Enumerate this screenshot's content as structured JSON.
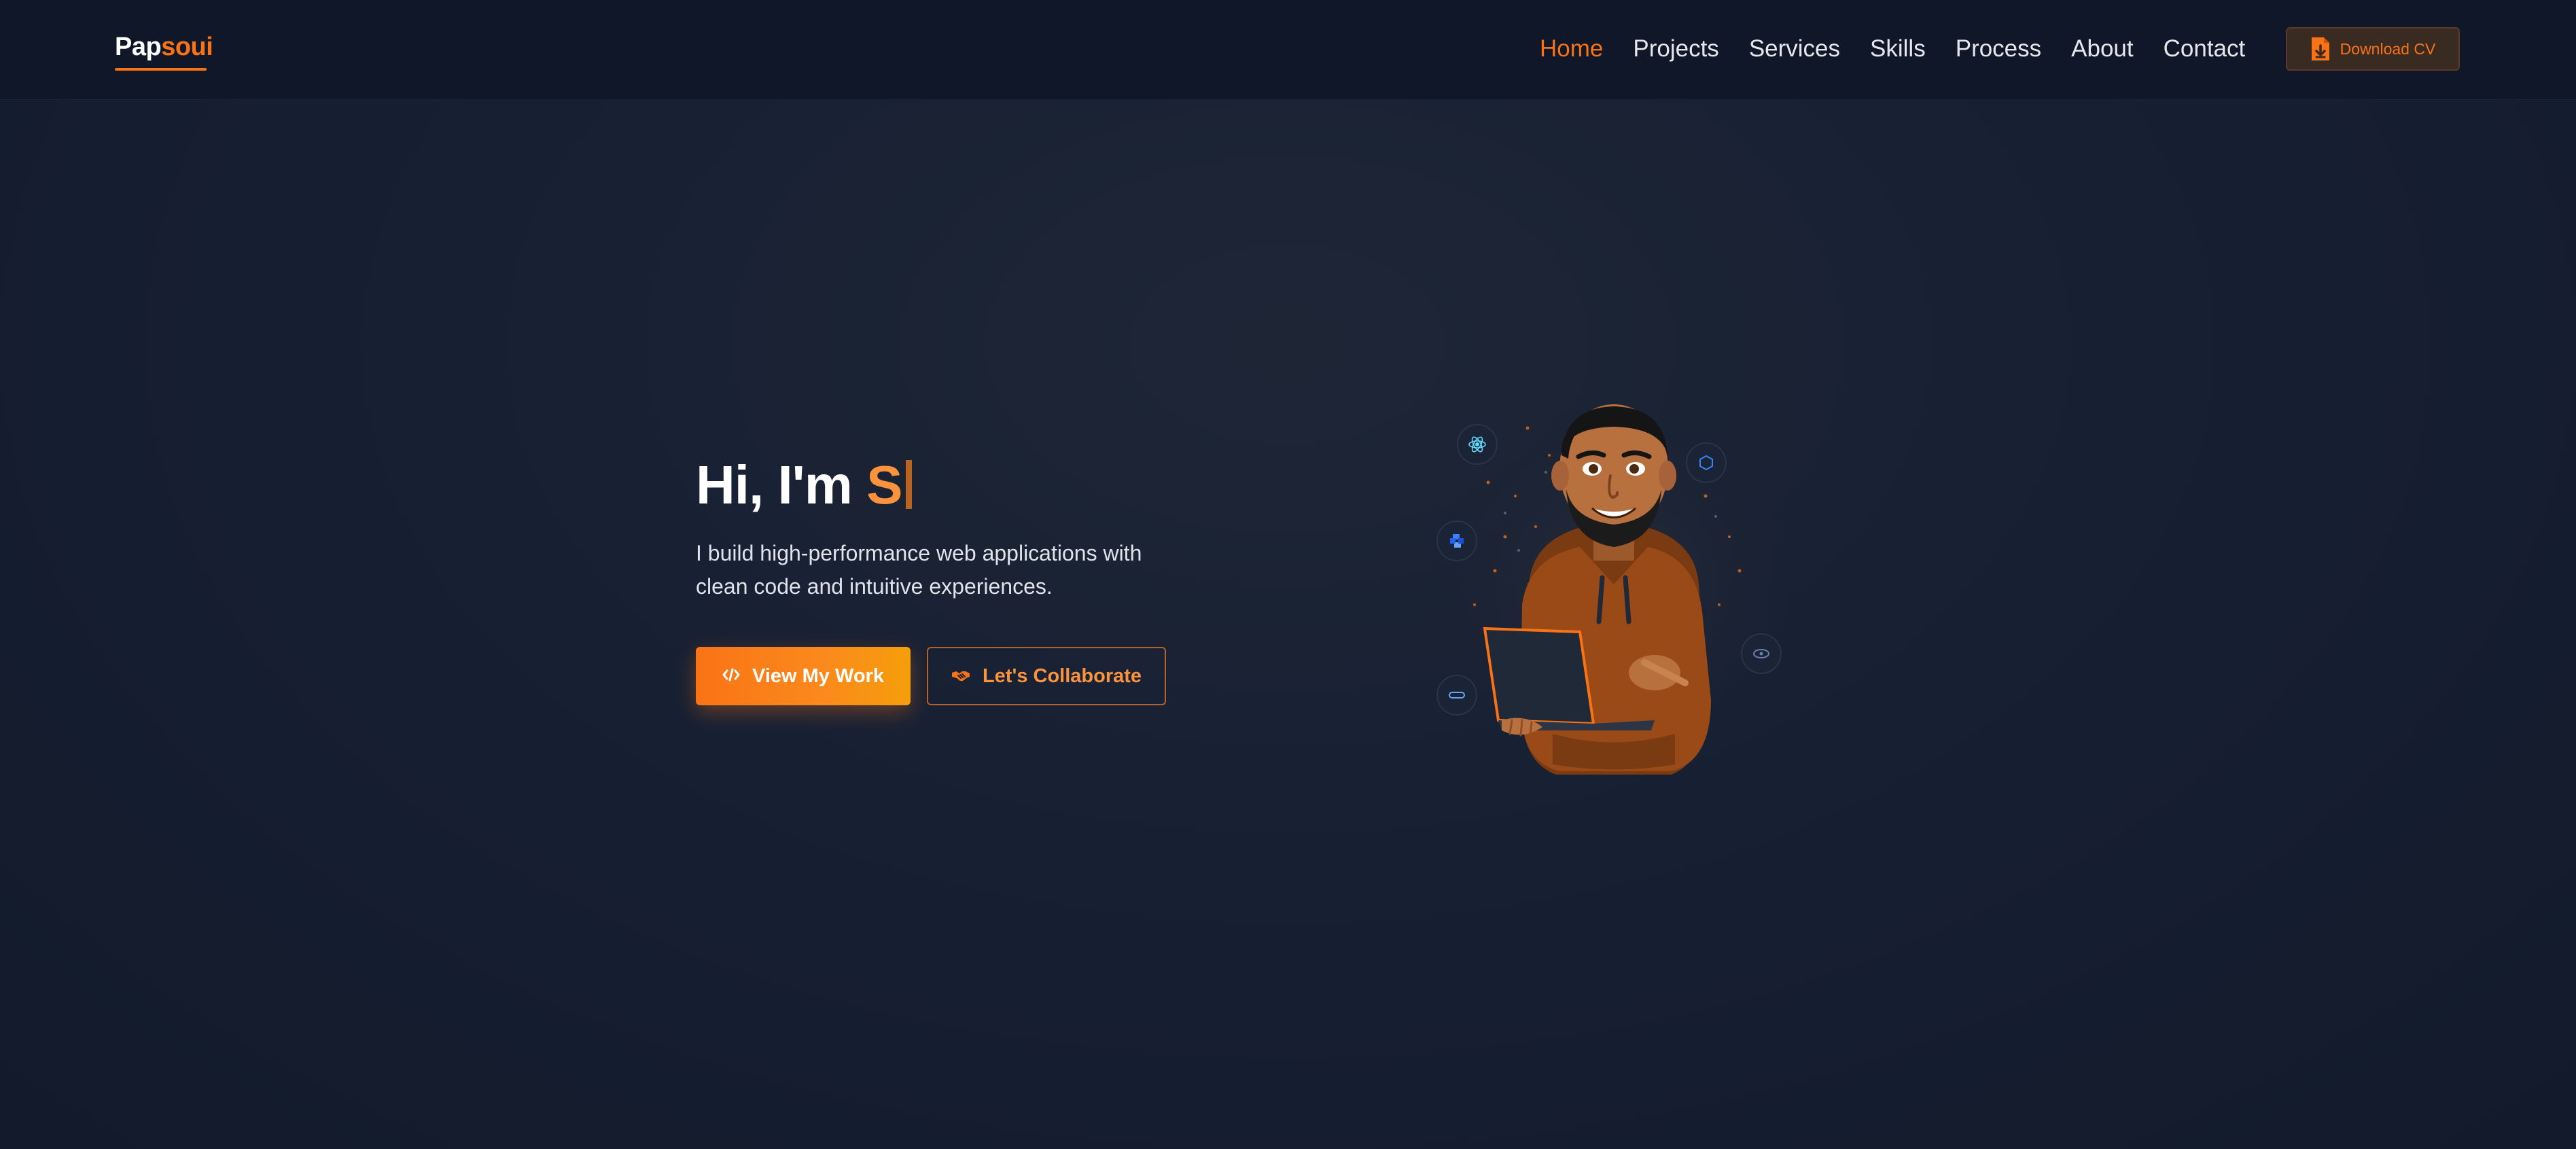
{
  "brand": {
    "prefix": "Pap",
    "suffix": "soui",
    "accent": "#f97316"
  },
  "nav": {
    "items": [
      {
        "label": "Home",
        "active": true
      },
      {
        "label": "Projects",
        "active": false
      },
      {
        "label": "Services",
        "active": false
      },
      {
        "label": "Skills",
        "active": false
      },
      {
        "label": "Process",
        "active": false
      },
      {
        "label": "About",
        "active": false
      },
      {
        "label": "Contact",
        "active": false
      }
    ],
    "cv_button": {
      "label": "Download CV",
      "icon": "file-download-icon"
    }
  },
  "hero": {
    "greeting": "Hi, I'm ",
    "typed_name": "S",
    "subtitle": "I build high-performance web applications with clean code and intuitive experiences.",
    "primary_button": {
      "label": "View My Work",
      "icon": "code-icon"
    },
    "secondary_button": {
      "label": "Let's Collaborate",
      "icon": "handshake-icon"
    }
  },
  "illustration": {
    "tech_icons": [
      "react-icon",
      "node-icon",
      "python-icon",
      "database-icon",
      "docker-icon"
    ]
  },
  "colors": {
    "background": "#172033",
    "navbar": "#0f1729",
    "accent": "#f97316",
    "text": "#e5e7eb"
  }
}
